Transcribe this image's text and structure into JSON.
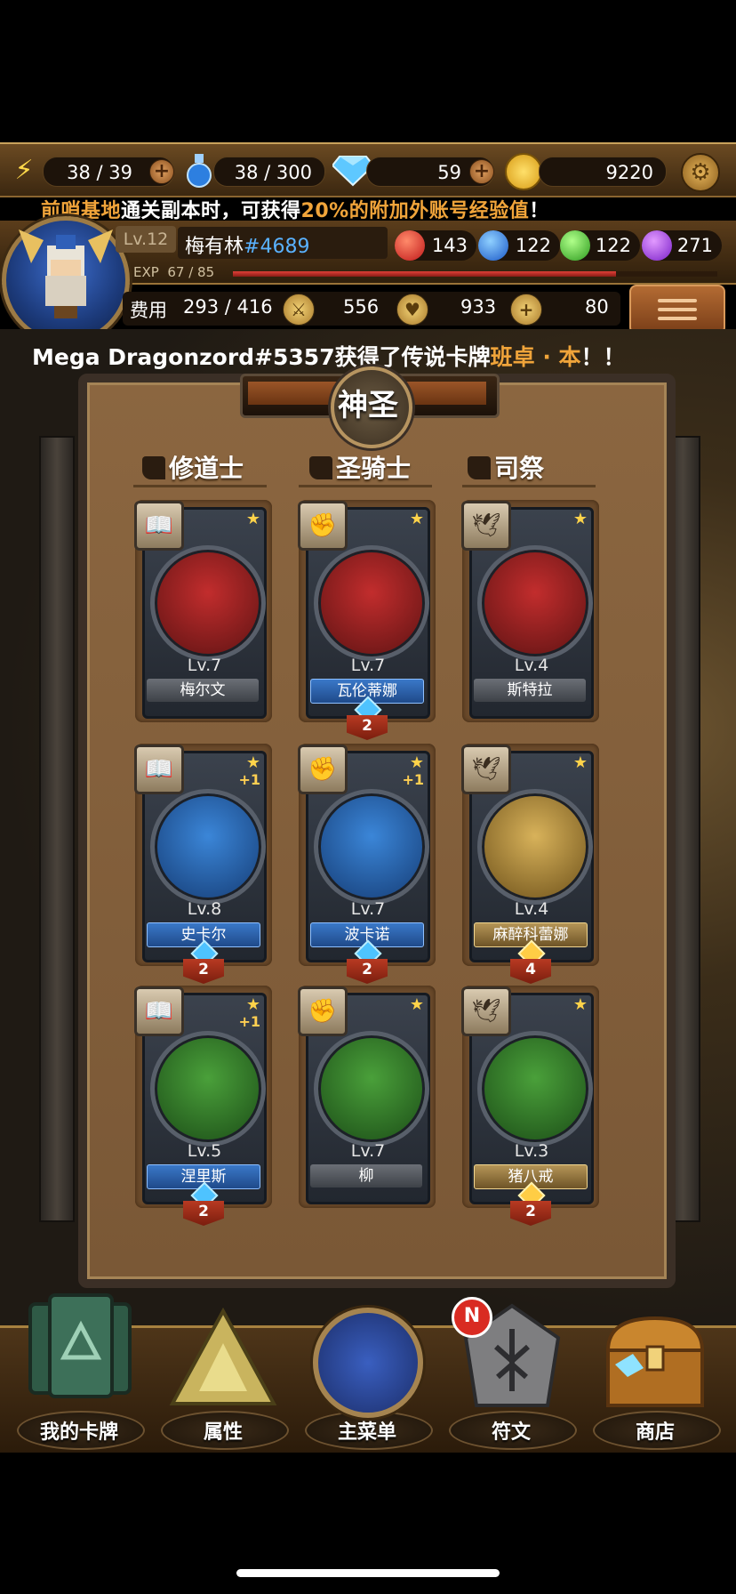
{
  "resources": {
    "stamina": "38 / 39",
    "potion": "38 / 300",
    "gems": "59",
    "gold": "9220"
  },
  "notice": {
    "part1": "前哨基地",
    "part2": "通关副本时，可获得",
    "part3": "20%的附加外账号经验值",
    "part4": "！"
  },
  "profile": {
    "level": "Lv.12",
    "name": "梅有林",
    "tag": "#4689",
    "exp_label": "EXP",
    "exp_value": "67 / 85",
    "exp_fraction": 0.79
  },
  "orbs": {
    "red": "143",
    "blue": "122",
    "green": "122",
    "purple": "271"
  },
  "stats": {
    "cost_label": "费用",
    "cost": "293 / 416",
    "attack": "556",
    "health": "933",
    "heal": "80"
  },
  "announcement": {
    "text": "Mega Dragonzord#5357获得了传说卡牌",
    "card": "班卓 · 本",
    "end": "！！"
  },
  "board": {
    "title": "神圣",
    "columns": [
      "修道士",
      "圣骑士",
      "司祭"
    ]
  },
  "cards": [
    {
      "level": "Lv.7",
      "name": "梅尔文",
      "style": "gray",
      "dup": "",
      "plus": ""
    },
    {
      "level": "Lv.7",
      "name": "瓦伦蒂娜",
      "style": "blue",
      "dup": "2",
      "plus": ""
    },
    {
      "level": "Lv.4",
      "name": "斯特拉",
      "style": "gray",
      "dup": "",
      "plus": ""
    },
    {
      "level": "Lv.8",
      "name": "史卡尔",
      "style": "blue",
      "dup": "2",
      "plus": "+1"
    },
    {
      "level": "Lv.7",
      "name": "波卡诺",
      "style": "blue",
      "dup": "2",
      "plus": "+1"
    },
    {
      "level": "Lv.4",
      "name": "麻醉科蕾娜",
      "style": "gold",
      "dup": "4",
      "plus": ""
    },
    {
      "level": "Lv.5",
      "name": "涅里斯",
      "style": "blue",
      "dup": "2",
      "plus": "+1"
    },
    {
      "level": "Lv.7",
      "name": "柳",
      "style": "gray",
      "dup": "",
      "plus": ""
    },
    {
      "level": "Lv.3",
      "name": "猪八戒",
      "style": "gold",
      "dup": "2",
      "plus": ""
    }
  ],
  "nav": {
    "my_cards": "我的卡牌",
    "attributes": "属性",
    "main_menu": "主菜单",
    "runes": "符文",
    "shop": "商店",
    "runes_badge": "N"
  },
  "colors": {
    "accent_orange": "#f0a43a",
    "tag_blue": "#5ab2ff",
    "badge_red": "#d92b22"
  }
}
